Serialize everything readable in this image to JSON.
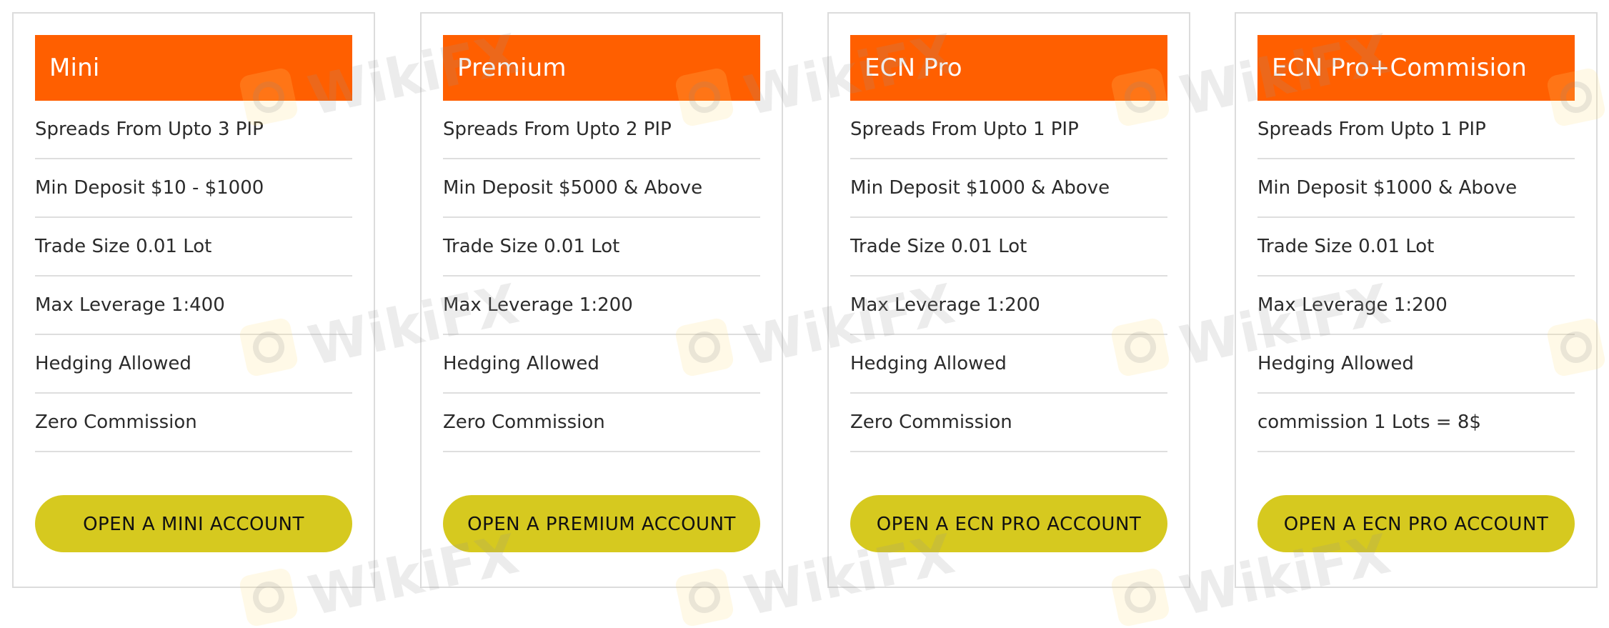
{
  "accent_colors": {
    "header_bg": "#ff5f00",
    "button_bg": "#d6c91f",
    "card_border": "#dcdcdc"
  },
  "watermark": {
    "text": "WikiFX",
    "logo_icon": "wikifx-eagle-logo-icon"
  },
  "cards": [
    {
      "title": "Mini",
      "features": [
        "Spreads From Upto 3 PIP",
        "Min Deposit $10 - $1000",
        "Trade Size 0.01 Lot",
        "Max Leverage 1:400",
        "Hedging Allowed",
        "Zero Commission"
      ],
      "button_label": "OPEN A MINI ACCOUNT"
    },
    {
      "title": "Premium",
      "features": [
        "Spreads From Upto 2 PIP",
        "Min Deposit $5000 & Above",
        "Trade Size 0.01 Lot",
        "Max Leverage 1:200",
        "Hedging Allowed",
        "Zero Commission"
      ],
      "button_label": "OPEN A PREMIUM ACCOUNT"
    },
    {
      "title": "ECN Pro",
      "features": [
        "Spreads From Upto 1 PIP",
        "Min Deposit $1000 & Above",
        "Trade Size 0.01 Lot",
        "Max Leverage 1:200",
        "Hedging Allowed",
        "Zero Commission"
      ],
      "button_label": "OPEN A ECN PRO ACCOUNT"
    },
    {
      "title": "ECN Pro+Commision",
      "features": [
        "Spreads From Upto 1 PIP",
        "Min Deposit $1000 & Above",
        "Trade Size 0.01 Lot",
        "Max Leverage 1:200",
        "Hedging Allowed",
        "commission 1 Lots = 8$"
      ],
      "button_label": "OPEN A ECN PRO ACCOUNT"
    }
  ]
}
